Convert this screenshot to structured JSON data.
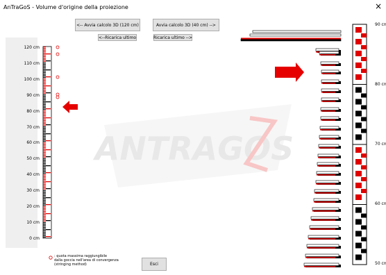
{
  "window": {
    "title": "AnTraGoS - Volume d'origine della proiezione",
    "close_glyph": "×"
  },
  "buttons": {
    "calc120": "<-- Avvia calcolo 3D (120 cm)",
    "calc40": "Avvia calcolo 3D (40 cm) -->",
    "reload_left": "<--Ricarica ultimo",
    "reload_right": "Ricarica ultimo -->",
    "exit": "Esci"
  },
  "left_scale": {
    "labels": [
      "120 cm",
      "110 cm",
      "100 cm",
      "90 cm",
      "80 cm",
      "70 cm",
      "60 cm",
      "50 cm",
      "40 cm",
      "30 cm",
      "20 cm",
      "10 cm",
      "0 cm"
    ]
  },
  "right_scale": {
    "labels": [
      "90 cm",
      "80 cm",
      "70 cm",
      "60 cm",
      "50 cm"
    ]
  },
  "legend": {
    "line1": ": quota massima raggiungibile",
    "line2": "dalla goccia nell'area di convergenza",
    "line3": "(stringing method)"
  },
  "watermark": {
    "text": "ANTRAGOS"
  },
  "colors": {
    "red": "#e00000",
    "black": "#000000",
    "accent_arrow": "#e60000"
  }
}
